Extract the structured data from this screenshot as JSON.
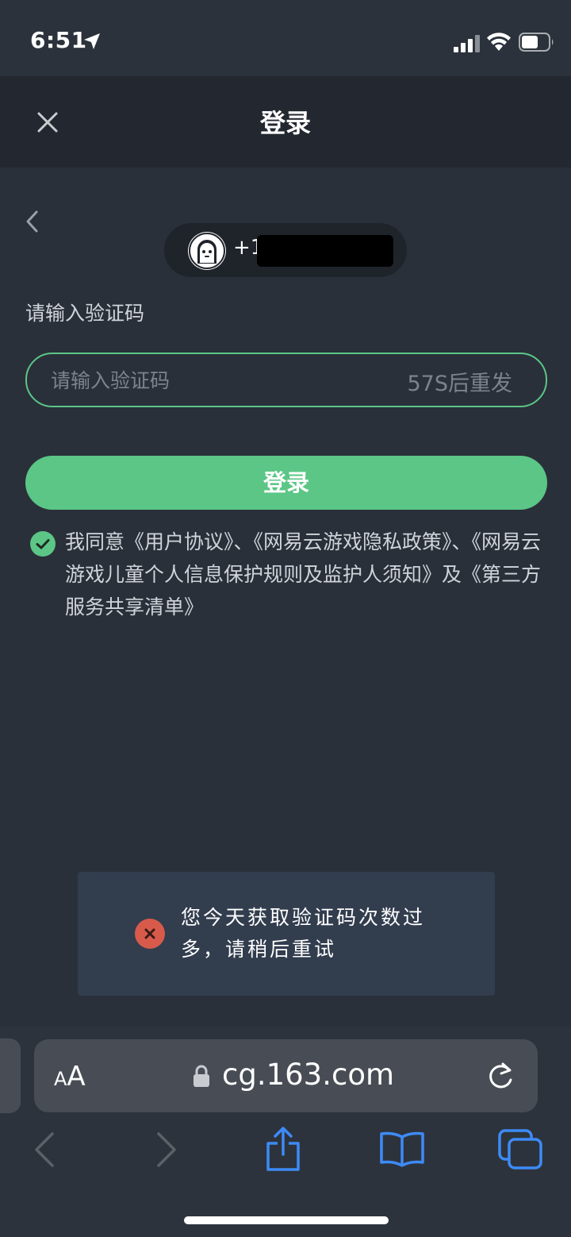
{
  "status_bar": {
    "time": "6:51",
    "icons": [
      "location-arrow-icon",
      "signal-icon",
      "wifi-icon",
      "battery-icon"
    ]
  },
  "nav": {
    "title": "登录",
    "close_icon": "close-icon"
  },
  "back_icon": "chevron-left-icon",
  "account": {
    "avatar_icon": "ghost-avatar-icon",
    "phone_prefix": "+1"
  },
  "code": {
    "label": "请输入验证码",
    "input_value": "",
    "input_placeholder": "请输入验证码",
    "resend_label": "57S后重发"
  },
  "login_button_label": "登录",
  "agreement": {
    "checked": true,
    "text": "我同意《用户协议》、《网易云游戏隐私政策》、《网易云游戏儿童个人信息保护规则及监护人须知》及《第三方服务共享清单》"
  },
  "toast": {
    "icon": "error-icon",
    "message": "您今天获取验证码次数过多，请稍后重试"
  },
  "browser": {
    "text_size_label_small": "A",
    "text_size_label_large": "A",
    "url": "cg.163.com",
    "toolbar_icons": [
      "back-icon",
      "forward-icon",
      "share-icon",
      "bookmarks-icon",
      "tabs-icon"
    ]
  },
  "colors": {
    "accent_green": "#5bc686",
    "background": "#2a303a",
    "toast_background": "#323d4e",
    "error_red": "#d85a4b",
    "safari_blue": "#3d8bf7"
  }
}
